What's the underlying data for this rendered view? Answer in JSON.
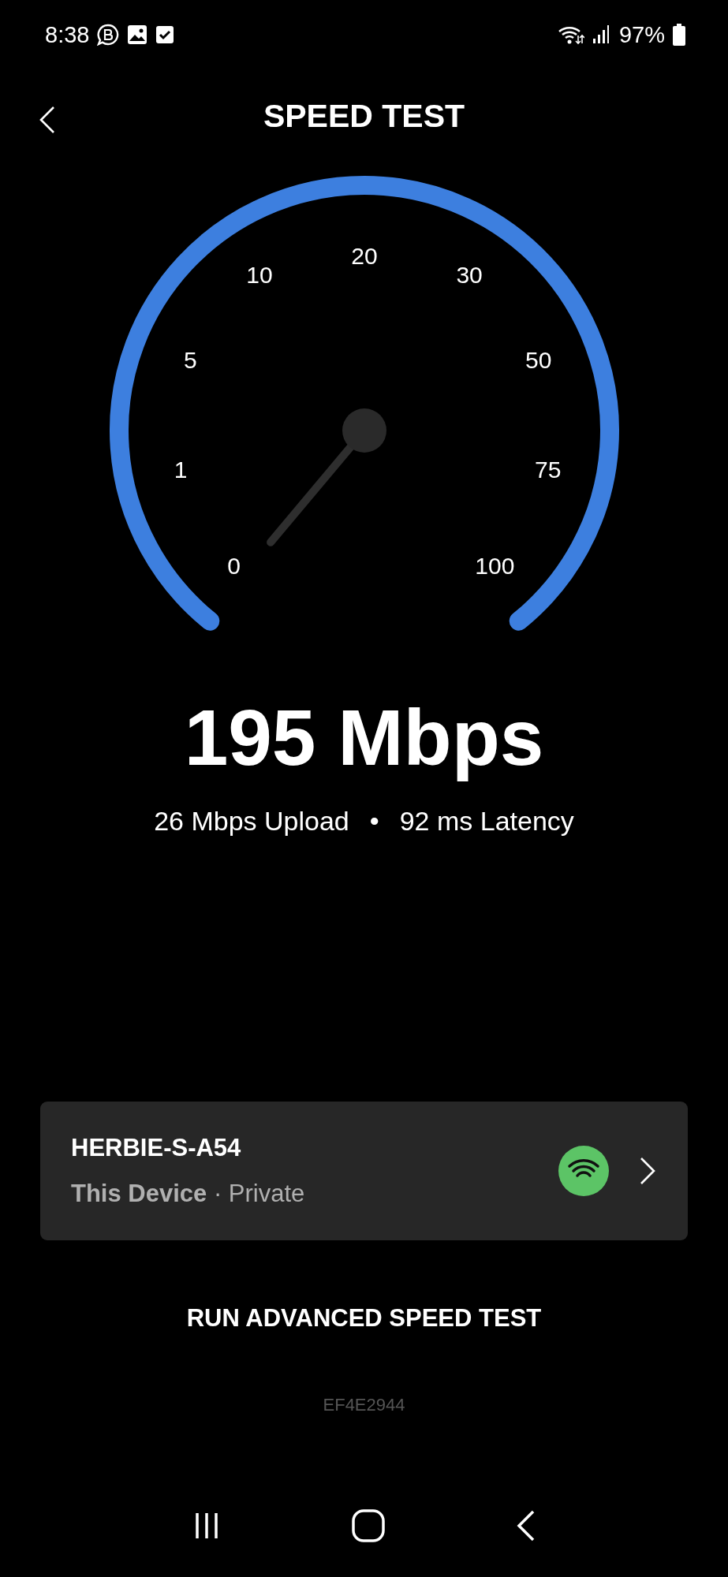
{
  "status_bar": {
    "time": "8:38",
    "battery": "97%"
  },
  "header": {
    "title": "SPEED TEST"
  },
  "gauge": {
    "labels": [
      "0",
      "1",
      "5",
      "10",
      "20",
      "30",
      "50",
      "75",
      "100"
    ]
  },
  "result": {
    "download": "195 Mbps",
    "upload": "26 Mbps Upload",
    "separator": "•",
    "latency": "92 ms Latency"
  },
  "device": {
    "name": "HERBIE-S-A54",
    "label": "This Device",
    "separator": "·",
    "privacy": "Private"
  },
  "advanced_button": "RUN ADVANCED SPEED TEST",
  "device_code": "EF4E2944"
}
